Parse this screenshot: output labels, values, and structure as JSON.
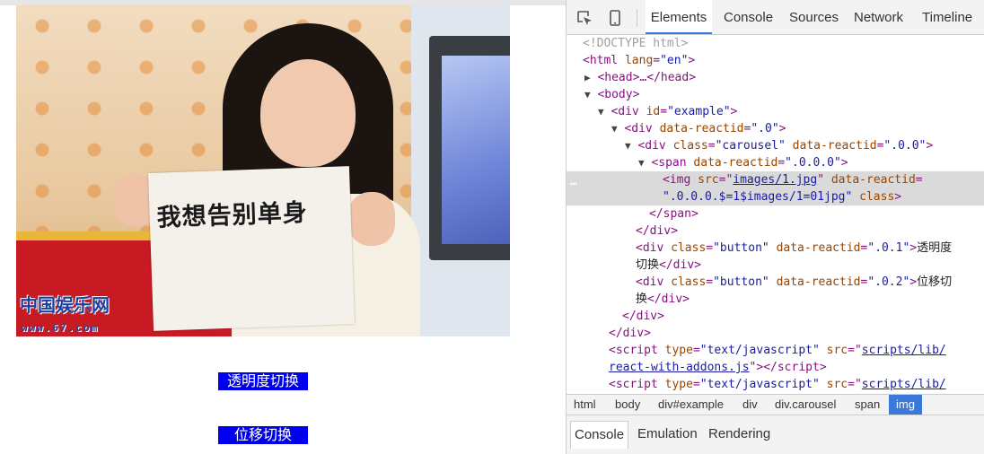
{
  "page": {
    "photo": {
      "sign_text": "我想告别单身",
      "logo_text": "中国娱乐网",
      "logo_url": "www.67.com"
    },
    "buttons": [
      "透明度切换",
      "位移切换"
    ]
  },
  "devtools": {
    "tabs": [
      "Elements",
      "Console",
      "Sources",
      "Network",
      "Timeline"
    ],
    "active_tab": "Elements",
    "dom": {
      "doctype": "<!DOCTYPE html>",
      "html_tag": "html",
      "html_attr": "lang",
      "html_val": "\"en\"",
      "head_collapsed": "<head>…</head>",
      "body_tag": "<body>",
      "div_example_attr": "id",
      "div_example_val": "\"example\"",
      "reactid_attr": "data-reactid",
      "reactid_0": "\".0\"",
      "class_attr": "class",
      "carousel_val": "\"carousel\"",
      "reactid_00": "\".0.0\"",
      "reactid_000": "\".0.0.0\"",
      "img_src_attr": "src",
      "img_src": "images/1.jpg",
      "img_reactid": "\".0.0.0.$=1$images/1=01jpg\"",
      "span_close": "</span>",
      "div_close": "</div>",
      "button_val": "\"button\"",
      "reactid_01": "\".0.1\"",
      "reactid_02": "\".0.2\"",
      "btn1_text_a": "透明度",
      "btn1_text_b": "切换",
      "btn2_text_a": "位移切",
      "btn2_text_b": "换",
      "script_type_attr": "type",
      "script_type_val": "\"text/javascript\"",
      "script_src_attr": "src",
      "script1_src_a": "scripts/lib/",
      "script1_src_b": "react-with-addons.js",
      "script2_src_a": "scripts/lib/",
      "selected_marker": "…"
    },
    "breadcrumbs": [
      "html",
      "body",
      "div#example",
      "div",
      "div.carousel",
      "span",
      "img"
    ],
    "active_breadcrumb": "img",
    "drawer_tabs": [
      "Console",
      "Emulation",
      "Rendering"
    ],
    "active_drawer_tab": "Console",
    "colors": {
      "accent": "#3879d9",
      "tag": "#881280",
      "attr": "#994500",
      "value": "#1a1aa6"
    }
  }
}
